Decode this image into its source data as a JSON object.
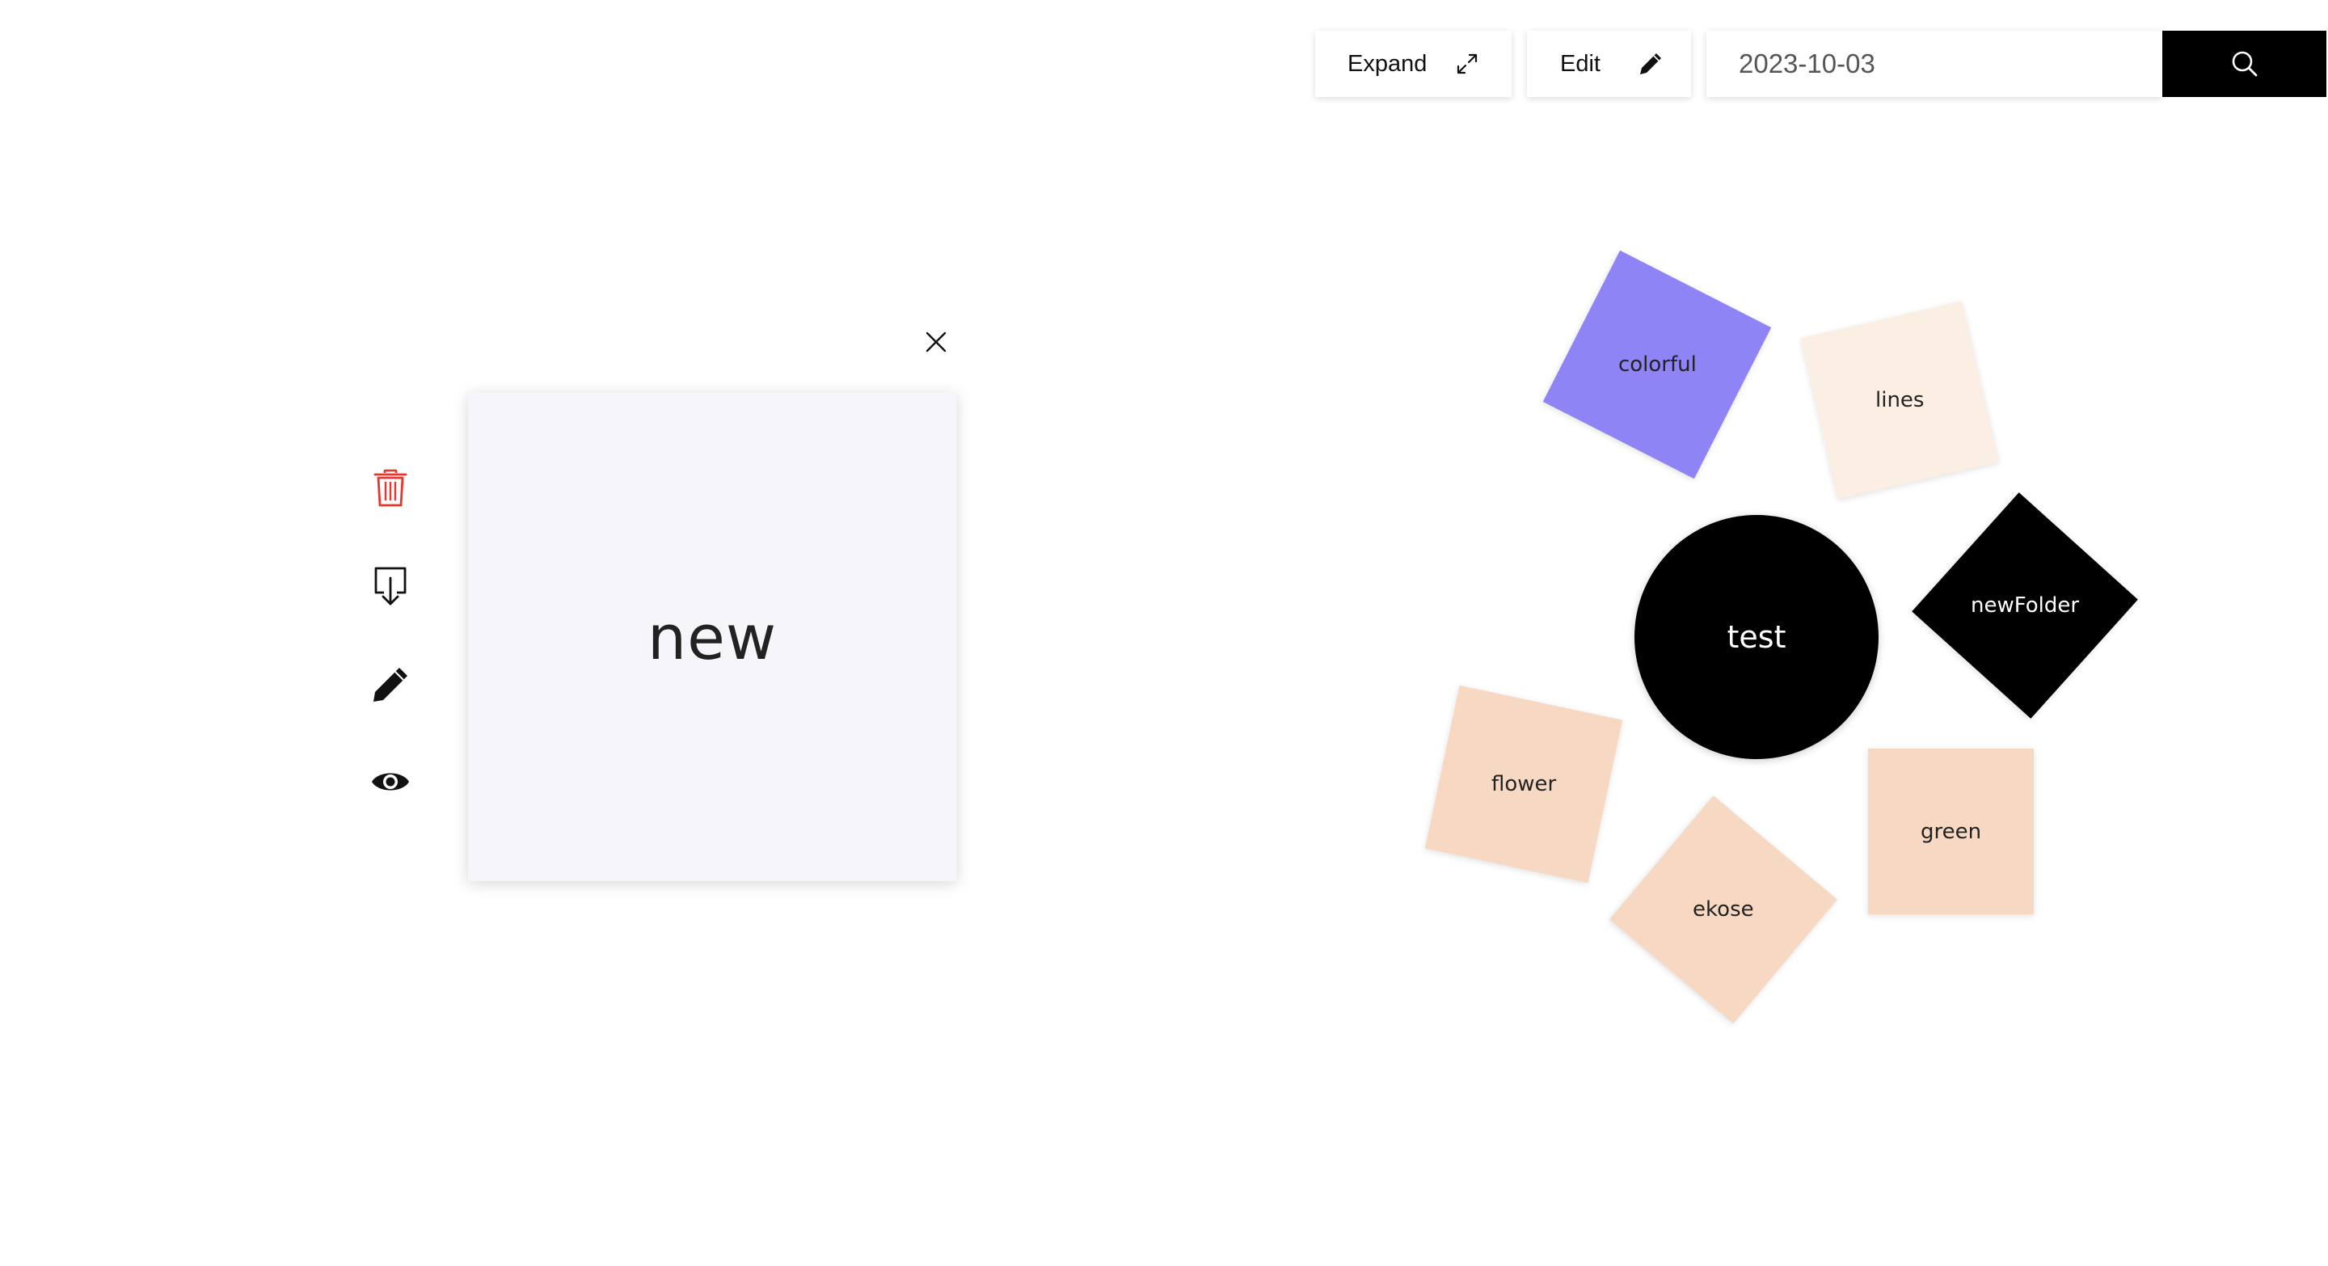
{
  "toolbar": {
    "expand_label": "Expand",
    "expand_icon": "expand-arrows-icon",
    "edit_label": "Edit",
    "edit_icon": "pen-icon",
    "search_value": "2023-10-03",
    "search_icon": "search-icon"
  },
  "side_actions": [
    {
      "name": "delete",
      "icon": "trash-icon",
      "color": "#e8352b"
    },
    {
      "name": "download",
      "icon": "download-icon",
      "color": "#111111"
    },
    {
      "name": "edit",
      "icon": "pen-icon",
      "color": "#111111"
    },
    {
      "name": "view",
      "icon": "eye-icon",
      "color": "#111111"
    }
  ],
  "preview": {
    "title": "new",
    "close_icon": "close-icon"
  },
  "center": {
    "label": "test",
    "color": "#000000"
  },
  "folders": [
    {
      "label": "colorful",
      "color": "#8f84f5"
    },
    {
      "label": "lines",
      "color": "#fbeee2"
    },
    {
      "label": "newFolder",
      "color": "#000000",
      "text_color": "#ffffff"
    },
    {
      "label": "flower",
      "color": "#f7d9c3"
    },
    {
      "label": "ekose",
      "color": "#f7d9c3"
    },
    {
      "label": "green",
      "color": "#f7d9c3"
    }
  ]
}
